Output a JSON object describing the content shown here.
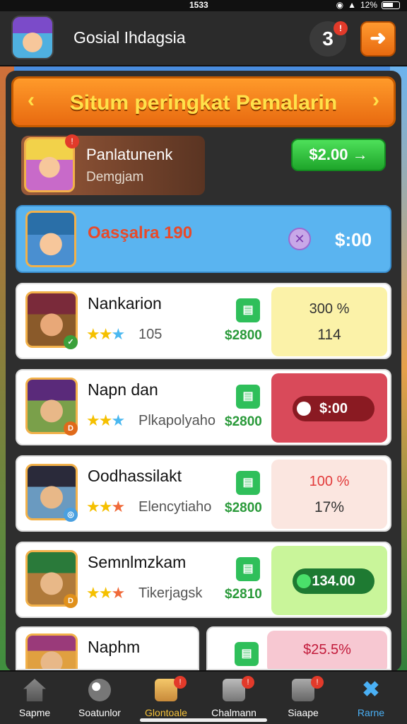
{
  "status_bar": {
    "time": "1533",
    "battery": "12%"
  },
  "header": {
    "title": "Gosial Ihdagsia",
    "badge": "3",
    "badge_dot": "!"
  },
  "banner": {
    "title": "Situm peringkat Pemalarin"
  },
  "player": {
    "name": "Panlatunenk",
    "subtitle": "Demgjam",
    "dot": "!",
    "button_label": "$2.00 →"
  },
  "highlight_row": {
    "name": "Oasşalra 190",
    "amount": "$:00"
  },
  "rows": [
    {
      "name": "Nankarion",
      "sub": "105",
      "cash": "$2800",
      "panel_top": "300 %",
      "panel_bottom": "114",
      "panel_color": "#fbf2a8",
      "panel_top_color": "#333",
      "panel_bottom_color": "#333"
    },
    {
      "name": "Napn dan",
      "sub": "Plkapolyaho",
      "cash": "$2800",
      "pill": "$:00",
      "panel_color": "#d94a5a",
      "pill_color": "#8a1a22"
    },
    {
      "name": "Oodhassilakt",
      "sub": "Elencytiaho",
      "cash": "$2800",
      "panel_top": "100 %",
      "panel_bottom": "17%",
      "panel_color": "#fbe6e0",
      "panel_top_color": "#e23a3a",
      "panel_bottom_color": "#333"
    },
    {
      "name": "Semnlmzkam",
      "sub": "Tikerjagsk",
      "cash": "$2810",
      "pill": "134.00",
      "panel_color": "#c9f59a",
      "pill_color": "#1e7a32"
    }
  ],
  "partial_row": {
    "name": "Naphm",
    "panel_top": "$25.5%"
  },
  "nav": [
    {
      "label": "Sapme",
      "color": "#fff"
    },
    {
      "label": "Soatunlor",
      "color": "#fff"
    },
    {
      "label": "Glontoale",
      "color": "#f5c23a",
      "dot": "!"
    },
    {
      "label": "Chalmann",
      "color": "#fff",
      "dot": "!"
    },
    {
      "label": "Siaape",
      "color": "#fff",
      "dot": "!"
    },
    {
      "label": "Rarne",
      "color": "#4ab0f5"
    }
  ]
}
